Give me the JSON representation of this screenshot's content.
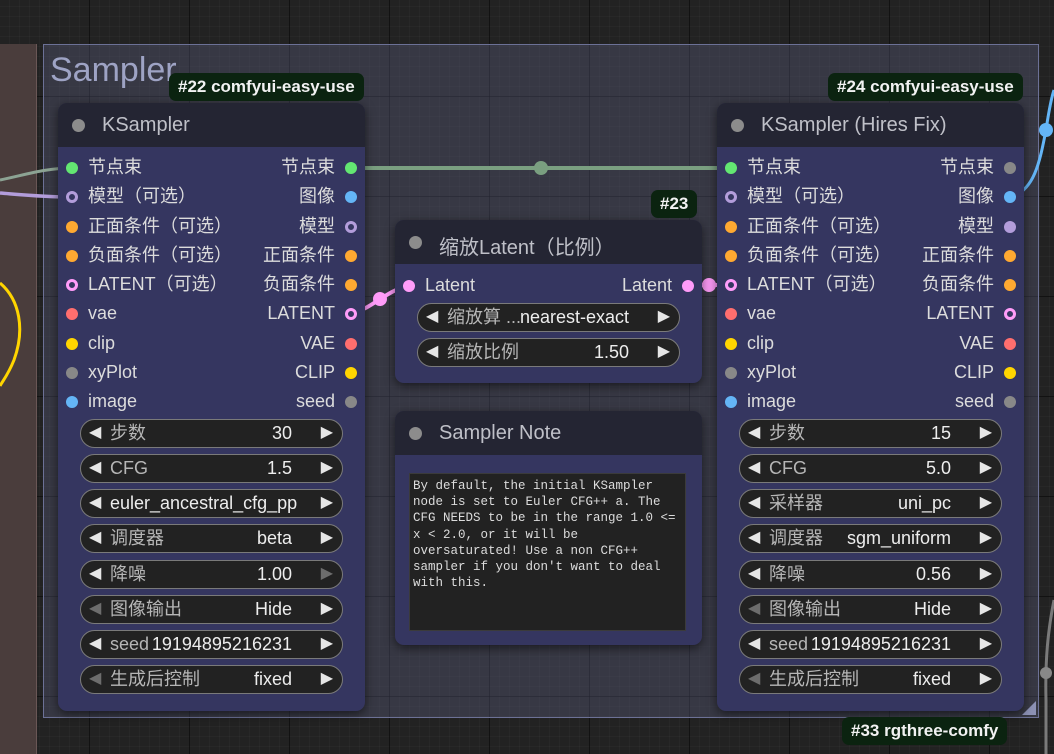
{
  "group": {
    "title": "Sampler"
  },
  "badges": {
    "node22": "#22 comfyui-easy-use",
    "node24": "#24 comfyui-easy-use",
    "node23": "#23",
    "node33": "#33 rgthree-comfy"
  },
  "colors": {
    "pipe": "#63e672",
    "model": "#b39ddb",
    "image": "#64b5f6",
    "conditioning": "#ffa931",
    "latent": "#ff9cf9",
    "vae": "#ff6e6e",
    "clip": "#ffd500",
    "xyplot": "#888888",
    "seed": "#888888",
    "link_pipe": "#7a9f80",
    "link_latent": "#ff9cf9"
  },
  "ksampler": {
    "title": "KSampler",
    "inputs": [
      {
        "label": "节点束",
        "color": "#63e672"
      },
      {
        "label": "模型（可选）",
        "color": "#b39ddb"
      },
      {
        "label": "正面条件（可选）",
        "color": "#ffa931"
      },
      {
        "label": "负面条件（可选）",
        "color": "#ffa931"
      },
      {
        "label": "LATENT（可选）",
        "color": "#ff9cf9"
      },
      {
        "label": "vae",
        "color": "#ff6e6e"
      },
      {
        "label": "clip",
        "color": "#ffd500"
      },
      {
        "label": "xyPlot",
        "color": "#888888"
      },
      {
        "label": "image",
        "color": "#64b5f6"
      }
    ],
    "outputs": [
      {
        "label": "节点束",
        "color": "#63e672"
      },
      {
        "label": "图像",
        "color": "#64b5f6"
      },
      {
        "label": "模型",
        "color": "#b39ddb"
      },
      {
        "label": "正面条件",
        "color": "#ffa931"
      },
      {
        "label": "负面条件",
        "color": "#ffa931"
      },
      {
        "label": "LATENT",
        "color": "#ff9cf9"
      },
      {
        "label": "VAE",
        "color": "#ff6e6e"
      },
      {
        "label": "CLIP",
        "color": "#ffd500"
      },
      {
        "label": "seed",
        "color": "#888888"
      }
    ],
    "widgets": [
      {
        "label": "步数",
        "value": "30"
      },
      {
        "label": "CFG",
        "value": "1.5"
      },
      {
        "label": "",
        "value": "euler_ancestral_cfg_pp"
      },
      {
        "label": "调度器",
        "value": "beta"
      },
      {
        "label": "降噪",
        "value": "1.00"
      },
      {
        "label": "图像输出",
        "value": "Hide"
      },
      {
        "label": "seed",
        "value": "19194895216231"
      },
      {
        "label": "生成后控制",
        "value": "fixed"
      }
    ]
  },
  "ksampler_hires": {
    "title": "KSampler (Hires Fix)",
    "inputs": [
      {
        "label": "节点束",
        "color": "#63e672"
      },
      {
        "label": "模型（可选）",
        "color": "#b39ddb"
      },
      {
        "label": "正面条件（可选）",
        "color": "#ffa931"
      },
      {
        "label": "负面条件（可选）",
        "color": "#ffa931"
      },
      {
        "label": "LATENT（可选）",
        "color": "#ff9cf9"
      },
      {
        "label": "vae",
        "color": "#ff6e6e"
      },
      {
        "label": "clip",
        "color": "#ffd500"
      },
      {
        "label": "xyPlot",
        "color": "#888888"
      },
      {
        "label": "image",
        "color": "#64b5f6"
      }
    ],
    "outputs": [
      {
        "label": "节点束",
        "color": "#888888"
      },
      {
        "label": "图像",
        "color": "#64b5f6"
      },
      {
        "label": "模型",
        "color": "#b39ddb"
      },
      {
        "label": "正面条件",
        "color": "#ffa931"
      },
      {
        "label": "负面条件",
        "color": "#ffa931"
      },
      {
        "label": "LATENT",
        "color": "#ff9cf9"
      },
      {
        "label": "VAE",
        "color": "#ff6e6e"
      },
      {
        "label": "CLIP",
        "color": "#ffd500"
      },
      {
        "label": "seed",
        "color": "#888888"
      }
    ],
    "widgets": [
      {
        "label": "步数",
        "value": "15"
      },
      {
        "label": "CFG",
        "value": "5.0"
      },
      {
        "label": "采样器",
        "value": "uni_pc"
      },
      {
        "label": "调度器",
        "value": "sgm_uniform"
      },
      {
        "label": "降噪",
        "value": "0.56"
      },
      {
        "label": "图像输出",
        "value": "Hide"
      },
      {
        "label": "seed",
        "value": "19194895216231"
      },
      {
        "label": "生成后控制",
        "value": "fixed"
      }
    ]
  },
  "latent_scale": {
    "title": "缩放Latent（比例）",
    "input": {
      "label": "Latent",
      "color": "#ff9cf9"
    },
    "output": {
      "label": "Latent",
      "color": "#ff9cf9"
    },
    "widgets": [
      {
        "label": "缩放算 ...",
        "value": "nearest-exact"
      },
      {
        "label": "缩放比例",
        "value": "1.50"
      }
    ]
  },
  "sampler_note": {
    "title": "Sampler Note",
    "text": "By default, the initial KSampler node is set to Euler CFG++ a. The CFG NEEDS to be in the range 1.0 <= x < 2.0, or it will be oversaturated! Use a non CFG++ sampler if you don't want to deal with this."
  }
}
